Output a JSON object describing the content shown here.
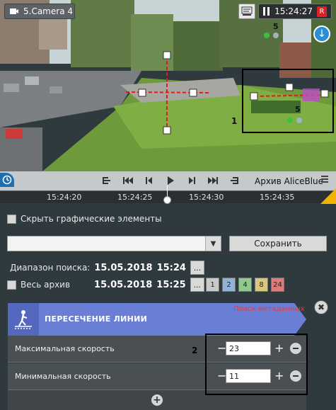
{
  "camera": {
    "title": "5.Camera 4",
    "time": "15:24:27",
    "rec_badge": "R",
    "overlay_label_1": "1",
    "overlay_label_5": "5",
    "overlay_label_5b": "5"
  },
  "playbar": {
    "archive_label": "Архив AliceBlue",
    "timeline_ticks": [
      "15:24:20",
      "15:24:25",
      "15:24:30",
      "15:24:35"
    ]
  },
  "panel": {
    "hide_graphics_label": "Скрыть графические элементы",
    "save_label": "Сохранить",
    "search_range_label": "Диапазон поиска:",
    "date_from": "15.05.2018",
    "time_from": "15:24",
    "whole_archive_label": "Весь архив",
    "date_to": "15.05.2018",
    "time_to": "15:25",
    "ellipsis": "...",
    "intervals": [
      "1",
      "2",
      "4",
      "8",
      "24"
    ],
    "interval_colors": [
      "#c9c9c9",
      "#8fb3d9",
      "#8fc98f",
      "#d9c77a",
      "#e07a7a"
    ]
  },
  "detector": {
    "title": "ПЕРЕСЕЧЕНИЕ ЛИНИИ",
    "meta_search_link": "Поиск метаданных",
    "close_glyph": "✖",
    "params": [
      {
        "label": "Максимальная скорость",
        "value": "23"
      },
      {
        "label": "Минимальная скорость",
        "value": "11"
      }
    ],
    "minus_glyph": "−",
    "plus_glyph": "+",
    "add_glyph": "+",
    "callout_label": "2"
  }
}
